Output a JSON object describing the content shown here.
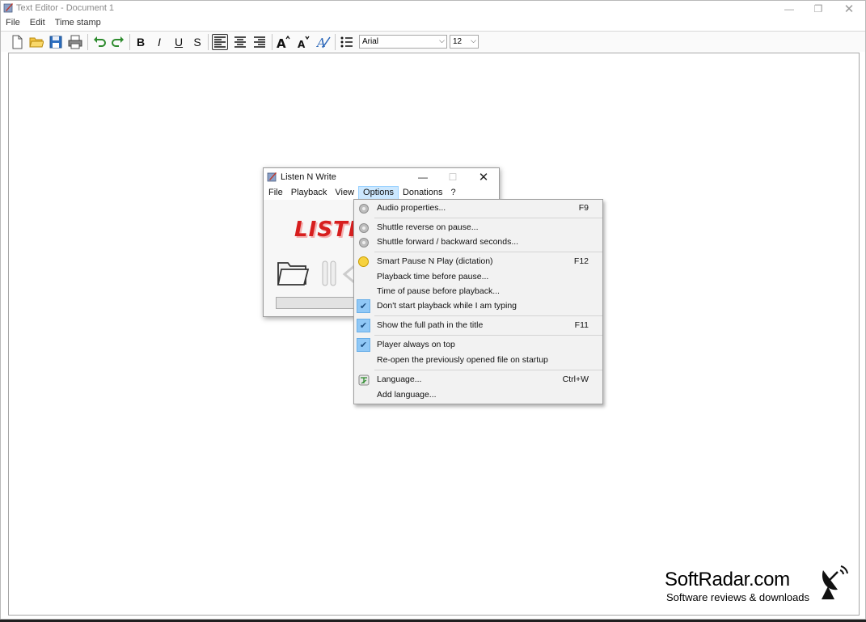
{
  "main_window": {
    "title": "Text Editor - Document 1",
    "menu": [
      "File",
      "Edit",
      "Time stamp"
    ]
  },
  "toolbar": {
    "bold_label": "B",
    "italic_label": "I",
    "underline_label": "U",
    "strike_label": "S",
    "font_name": "Arial",
    "font_size": "12"
  },
  "popup": {
    "title": "Listen N Write",
    "menu": [
      "File",
      "Playback",
      "View",
      "Options",
      "Donations",
      "?"
    ],
    "logo_text": "LISTEN"
  },
  "options_menu": {
    "items": [
      {
        "label": "Audio properties...",
        "shortcut": "F9",
        "icon": "gear-icon",
        "checked": false
      },
      {
        "label": "Shuttle reverse on pause...",
        "shortcut": "",
        "icon": "gear-icon",
        "checked": false
      },
      {
        "label": "Shuttle forward / backward seconds...",
        "shortcut": "",
        "icon": "gear-icon",
        "checked": false
      },
      {
        "label": "Smart Pause N Play (dictation)",
        "shortcut": "F12",
        "icon": "smiley-icon",
        "checked": false
      },
      {
        "label": "Playback time before pause...",
        "shortcut": "",
        "icon": "",
        "checked": false
      },
      {
        "label": "Time of pause before playback...",
        "shortcut": "",
        "icon": "",
        "checked": false
      },
      {
        "label": "Don't start playback while I am typing",
        "shortcut": "",
        "icon": "check-icon",
        "checked": true
      },
      {
        "label": "Show the full path in the title",
        "shortcut": "F11",
        "icon": "check-icon",
        "checked": true
      },
      {
        "label": "Player always on top",
        "shortcut": "",
        "icon": "check-icon",
        "checked": true
      },
      {
        "label": "Re-open the previously opened file on startup",
        "shortcut": "",
        "icon": "",
        "checked": false
      },
      {
        "label": "Language...",
        "shortcut": "Ctrl+W",
        "icon": "language-icon",
        "checked": false
      },
      {
        "label": "Add language...",
        "shortcut": "",
        "icon": "",
        "checked": false
      }
    ]
  },
  "watermark": {
    "main": "SoftRadar.com",
    "sub": "Software reviews & downloads"
  },
  "colors": {
    "accent_check": "#90c8f6",
    "menu_open": "#cce8ff",
    "logo_red": "#d71e1e"
  }
}
